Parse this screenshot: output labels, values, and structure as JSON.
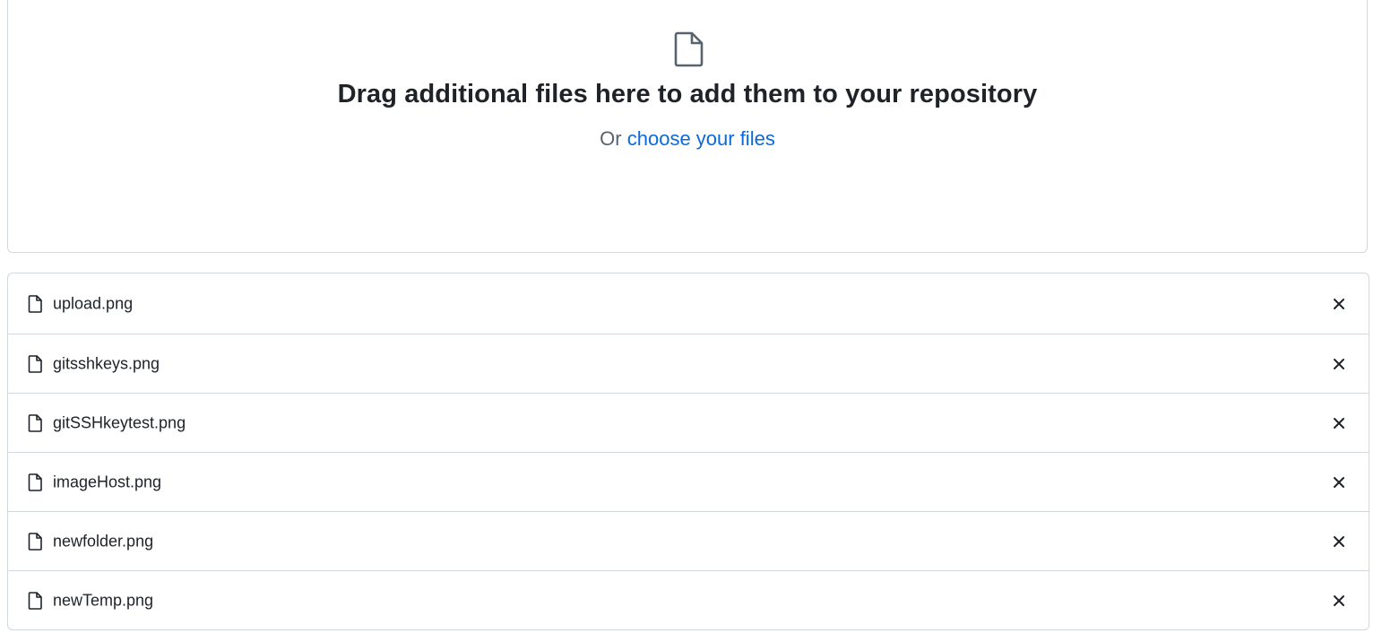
{
  "dropzone": {
    "icon": "file-icon",
    "heading": "Drag additional files here to add them to your repository",
    "prefix": "Or",
    "link_label": "choose your files"
  },
  "files": [
    {
      "name": "upload.png",
      "icon": "file-icon",
      "remove_icon": "x-icon"
    },
    {
      "name": "gitsshkeys.png",
      "icon": "file-icon",
      "remove_icon": "x-icon"
    },
    {
      "name": "gitSSHkeytest.png",
      "icon": "file-icon",
      "remove_icon": "x-icon"
    },
    {
      "name": "imageHost.png",
      "icon": "file-icon",
      "remove_icon": "x-icon"
    },
    {
      "name": "newfolder.png",
      "icon": "file-icon",
      "remove_icon": "x-icon"
    },
    {
      "name": "newTemp.png",
      "icon": "file-icon",
      "remove_icon": "x-icon"
    }
  ],
  "colors": {
    "link": "#0969da",
    "border": "#d0d7de",
    "text": "#1f2328",
    "muted": "#59636e",
    "icon": "#59636e"
  }
}
